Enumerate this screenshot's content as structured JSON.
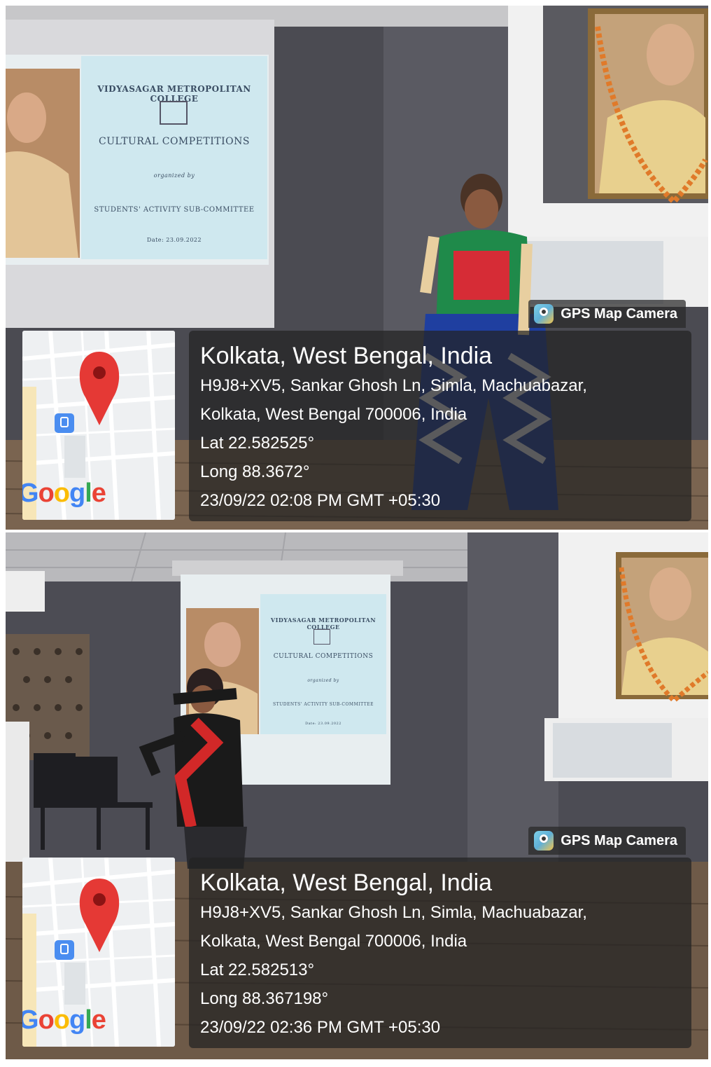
{
  "photos": [
    {
      "slide": {
        "college": "VIDYASAGAR METROPOLITAN COLLEGE",
        "event": "CULTURAL COMPETITIONS",
        "organized": "organized by",
        "committee": "STUDENTS' ACTIVITY SUB-COMMITTEE",
        "date": "Date: 23.09.2022"
      },
      "app_tag": "GPS Map Camera",
      "map_brand": "Google",
      "location": "Kolkata, West Bengal, India",
      "address_line1": "H9J8+XV5, Sankar Ghosh Ln, Simla, Machuabazar,",
      "address_line2": "Kolkata, West Bengal 700006, India",
      "lat": "Lat 22.582525°",
      "long": "Long 88.3672°",
      "timestamp": "23/09/22 02:08 PM GMT +05:30"
    },
    {
      "slide": {
        "college": "VIDYASAGAR METROPOLITAN COLLEGE",
        "event": "CULTURAL COMPETITIONS",
        "organized": "organized by",
        "committee": "STUDENTS' ACTIVITY SUB-COMMITTEE",
        "date": "Date: 23.09.2022"
      },
      "app_tag": "GPS Map Camera",
      "map_brand": "Google",
      "location": "Kolkata, West Bengal, India",
      "address_line1": "H9J8+XV5, Sankar Ghosh Ln, Simla, Machuabazar,",
      "address_line2": "Kolkata, West Bengal 700006, India",
      "lat": "Lat 22.582513°",
      "long": "Long 88.367198°",
      "timestamp": "23/09/22 02:36 PM GMT +05:30"
    }
  ],
  "colors": {
    "pin": "#E53935",
    "overlay": "#232323",
    "slide_bg": "#cfe8ef"
  }
}
